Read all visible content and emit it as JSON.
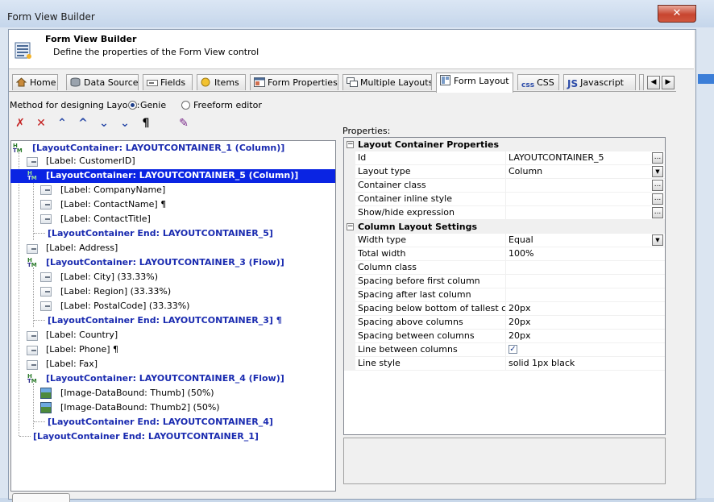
{
  "window": {
    "title": "Form View Builder",
    "close_glyph": "✕"
  },
  "header": {
    "title": "Form View Builder",
    "subtitle": "Define the properties of the Form View control"
  },
  "tabs": [
    {
      "label": "Home",
      "icon": "home-icon"
    },
    {
      "label": "Data Source",
      "icon": "database-icon"
    },
    {
      "label": "Fields",
      "icon": "fields-icon"
    },
    {
      "label": "Items",
      "icon": "items-icon"
    },
    {
      "label": "Form Properties",
      "icon": "form-properties-icon"
    },
    {
      "label": "Multiple Layouts",
      "icon": "multiple-layouts-icon"
    },
    {
      "label": "Form Layout",
      "icon": "form-layout-icon",
      "active": true
    },
    {
      "label": "CSS",
      "icon": "css-icon",
      "icon_text": "css"
    },
    {
      "label": "Javascript",
      "icon": "javascript-icon",
      "icon_text": "JS"
    }
  ],
  "method": {
    "label": "Method for designing Layout:",
    "options": [
      {
        "label": "Genie",
        "selected": true
      },
      {
        "label": "Freeform editor",
        "selected": false
      }
    ]
  },
  "toolbar": {
    "buttons": [
      {
        "name": "delete-all-icon",
        "glyph": "✗"
      },
      {
        "name": "delete-icon",
        "glyph": "✕"
      },
      {
        "name": "move-top-icon",
        "glyph": "⌃"
      },
      {
        "name": "move-up-icon",
        "glyph": "^"
      },
      {
        "name": "move-down-icon",
        "glyph": "⌄"
      },
      {
        "name": "move-bottom-icon",
        "glyph": "⌄"
      },
      {
        "name": "pilcrow-icon",
        "glyph": "¶"
      },
      {
        "name": "edit-brush-icon",
        "glyph": "✎"
      }
    ]
  },
  "tree": {
    "items": [
      {
        "text": "[LayoutContainer: LAYOUTCONTAINER_1 (Column)]",
        "kind": "container",
        "depth": 0
      },
      {
        "text": "[Label: CustomerID]",
        "kind": "label",
        "depth": 1
      },
      {
        "text": "[LayoutContainer: LAYOUTCONTAINER_5 (Column)]",
        "kind": "container",
        "depth": 1,
        "selected": true
      },
      {
        "text": "[Label: CompanyName]",
        "kind": "label",
        "depth": 2
      },
      {
        "text": "[Label: ContactName] ¶",
        "kind": "label",
        "depth": 2
      },
      {
        "text": "[Label: ContactTitle]",
        "kind": "label",
        "depth": 2
      },
      {
        "text": "[LayoutContainer End: LAYOUTCONTAINER_5]",
        "kind": "end",
        "depth": 1
      },
      {
        "text": "[Label: Address]",
        "kind": "label",
        "depth": 1
      },
      {
        "text": "[LayoutContainer: LAYOUTCONTAINER_3 (Flow)]",
        "kind": "container",
        "depth": 1
      },
      {
        "text": "[Label: City] (33.33%)",
        "kind": "label",
        "depth": 2
      },
      {
        "text": "[Label: Region] (33.33%)",
        "kind": "label",
        "depth": 2
      },
      {
        "text": "[Label: PostalCode] (33.33%)",
        "kind": "label",
        "depth": 2
      },
      {
        "text": "[LayoutContainer End: LAYOUTCONTAINER_3] ¶",
        "kind": "end",
        "depth": 1
      },
      {
        "text": "[Label: Country]",
        "kind": "label",
        "depth": 1
      },
      {
        "text": "[Label: Phone] ¶",
        "kind": "label",
        "depth": 1
      },
      {
        "text": "[Label: Fax]",
        "kind": "label",
        "depth": 1
      },
      {
        "text": "[LayoutContainer: LAYOUTCONTAINER_4 (Flow)]",
        "kind": "container",
        "depth": 1
      },
      {
        "text": "[Image-DataBound: Thumb] (50%)",
        "kind": "image",
        "depth": 2
      },
      {
        "text": "[Image-DataBound: Thumb2] (50%)",
        "kind": "image",
        "depth": 2
      },
      {
        "text": "[LayoutContainer End: LAYOUTCONTAINER_4]",
        "kind": "end",
        "depth": 1
      },
      {
        "text": "[LayoutContainer End: LAYOUTCONTAINER_1]",
        "kind": "end",
        "depth": 0
      }
    ]
  },
  "properties": {
    "label": "Properties:",
    "categories": [
      {
        "title": "Layout Container Properties",
        "toggle": "−",
        "rows": [
          {
            "name": "Id",
            "value": "LAYOUTCONTAINER_5",
            "button": "ellipsis"
          },
          {
            "name": "Layout type",
            "value": "Column",
            "button": "dropdown"
          },
          {
            "name": "Container class",
            "value": "",
            "button": "ellipsis"
          },
          {
            "name": "Container inline style",
            "value": "",
            "button": "ellipsis"
          },
          {
            "name": "Show/hide expression",
            "value": "",
            "button": "ellipsis"
          }
        ]
      },
      {
        "title": "Column Layout Settings",
        "toggle": "−",
        "rows": [
          {
            "name": "Width type",
            "value": "Equal",
            "button": "dropdown"
          },
          {
            "name": "Total width",
            "value": "100%"
          },
          {
            "name": "Column class",
            "value": ""
          },
          {
            "name": "Spacing before first column",
            "value": ""
          },
          {
            "name": "Spacing after last column",
            "value": ""
          },
          {
            "name": "Spacing below bottom of tallest column",
            "value": "20px"
          },
          {
            "name": "Spacing above columns",
            "value": "20px"
          },
          {
            "name": "Spacing between columns",
            "value": "20px"
          },
          {
            "name": "Line between columns",
            "value": "",
            "checked": true
          },
          {
            "name": "Line style",
            "value": "solid 1px black"
          }
        ]
      }
    ]
  },
  "glyphs": {
    "ellipsis": "...",
    "dropdown": "▼",
    "check": "✓",
    "scroll_left": "◀",
    "scroll_right": "▶"
  }
}
